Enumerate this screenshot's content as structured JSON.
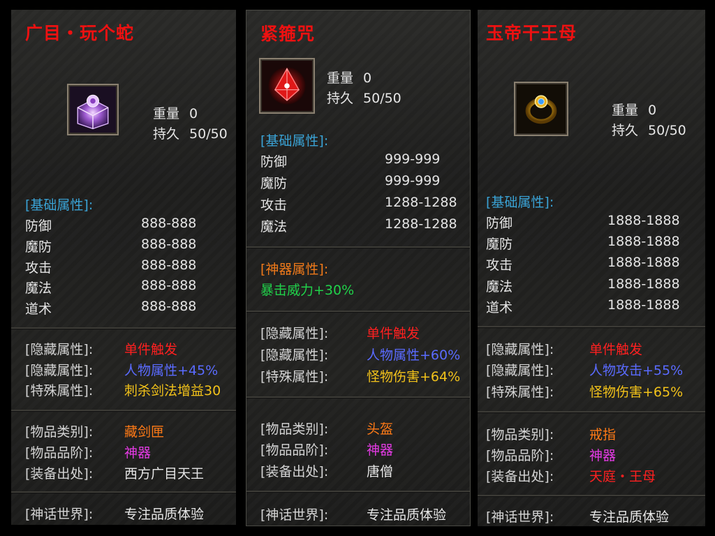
{
  "labels": {
    "weight": "重量",
    "durability": "持久",
    "base_header": "[基础属性]:",
    "artifact_header": "[神器属性]:",
    "hidden": "[隐藏属性]:",
    "special": "[特殊属性]:",
    "category": "[物品类别]:",
    "grade": "[物品品阶]:",
    "source": "[装备出处]:",
    "world": "[神话世界]:"
  },
  "panels": [
    {
      "title": "广目・玩个蛇",
      "icon": "treasure-box-icon",
      "weight": "0",
      "durability": "50/50",
      "stats": [
        {
          "name": "防御",
          "value": "888-888"
        },
        {
          "name": "魔防",
          "value": "888-888"
        },
        {
          "name": "攻击",
          "value": "888-888"
        },
        {
          "name": "魔法",
          "value": "888-888"
        },
        {
          "name": "道术",
          "value": "888-888"
        }
      ],
      "hidden_1": "单件触发",
      "hidden_2": "人物属性+45%",
      "special": "刺杀剑法增益30",
      "category": "藏剑匣",
      "grade": "神器",
      "source": "西方广目天王",
      "world": "专注品质体验"
    },
    {
      "title": "紧箍咒",
      "icon": "red-crystal-icon",
      "weight": "0",
      "durability": "50/50",
      "stats": [
        {
          "name": "防御",
          "value": "999-999"
        },
        {
          "name": "魔防",
          "value": "999-999"
        },
        {
          "name": "攻击",
          "value": "1288-1288"
        },
        {
          "name": "魔法",
          "value": "1288-1288"
        }
      ],
      "artifact_attr": "暴击威力+30%",
      "hidden_1": "单件触发",
      "hidden_2": "人物属性+60%",
      "special": "怪物伤害+64%",
      "category": "头盔",
      "grade": "神器",
      "source": "唐僧",
      "world": "专注品质体验"
    },
    {
      "title": "玉帝干王母",
      "icon": "gold-ring-icon",
      "weight": "0",
      "durability": "50/50",
      "stats": [
        {
          "name": "防御",
          "value": "1888-1888"
        },
        {
          "name": "魔防",
          "value": "1888-1888"
        },
        {
          "name": "攻击",
          "value": "1888-1888"
        },
        {
          "name": "魔法",
          "value": "1888-1888"
        },
        {
          "name": "道术",
          "value": "1888-1888"
        }
      ],
      "hidden_1": "单件触发",
      "hidden_2": "人物攻击+55%",
      "special": "怪物伤害+65%",
      "category": "戒指",
      "grade": "神器",
      "source": "天庭・王母",
      "world": "专注品质体验"
    }
  ]
}
